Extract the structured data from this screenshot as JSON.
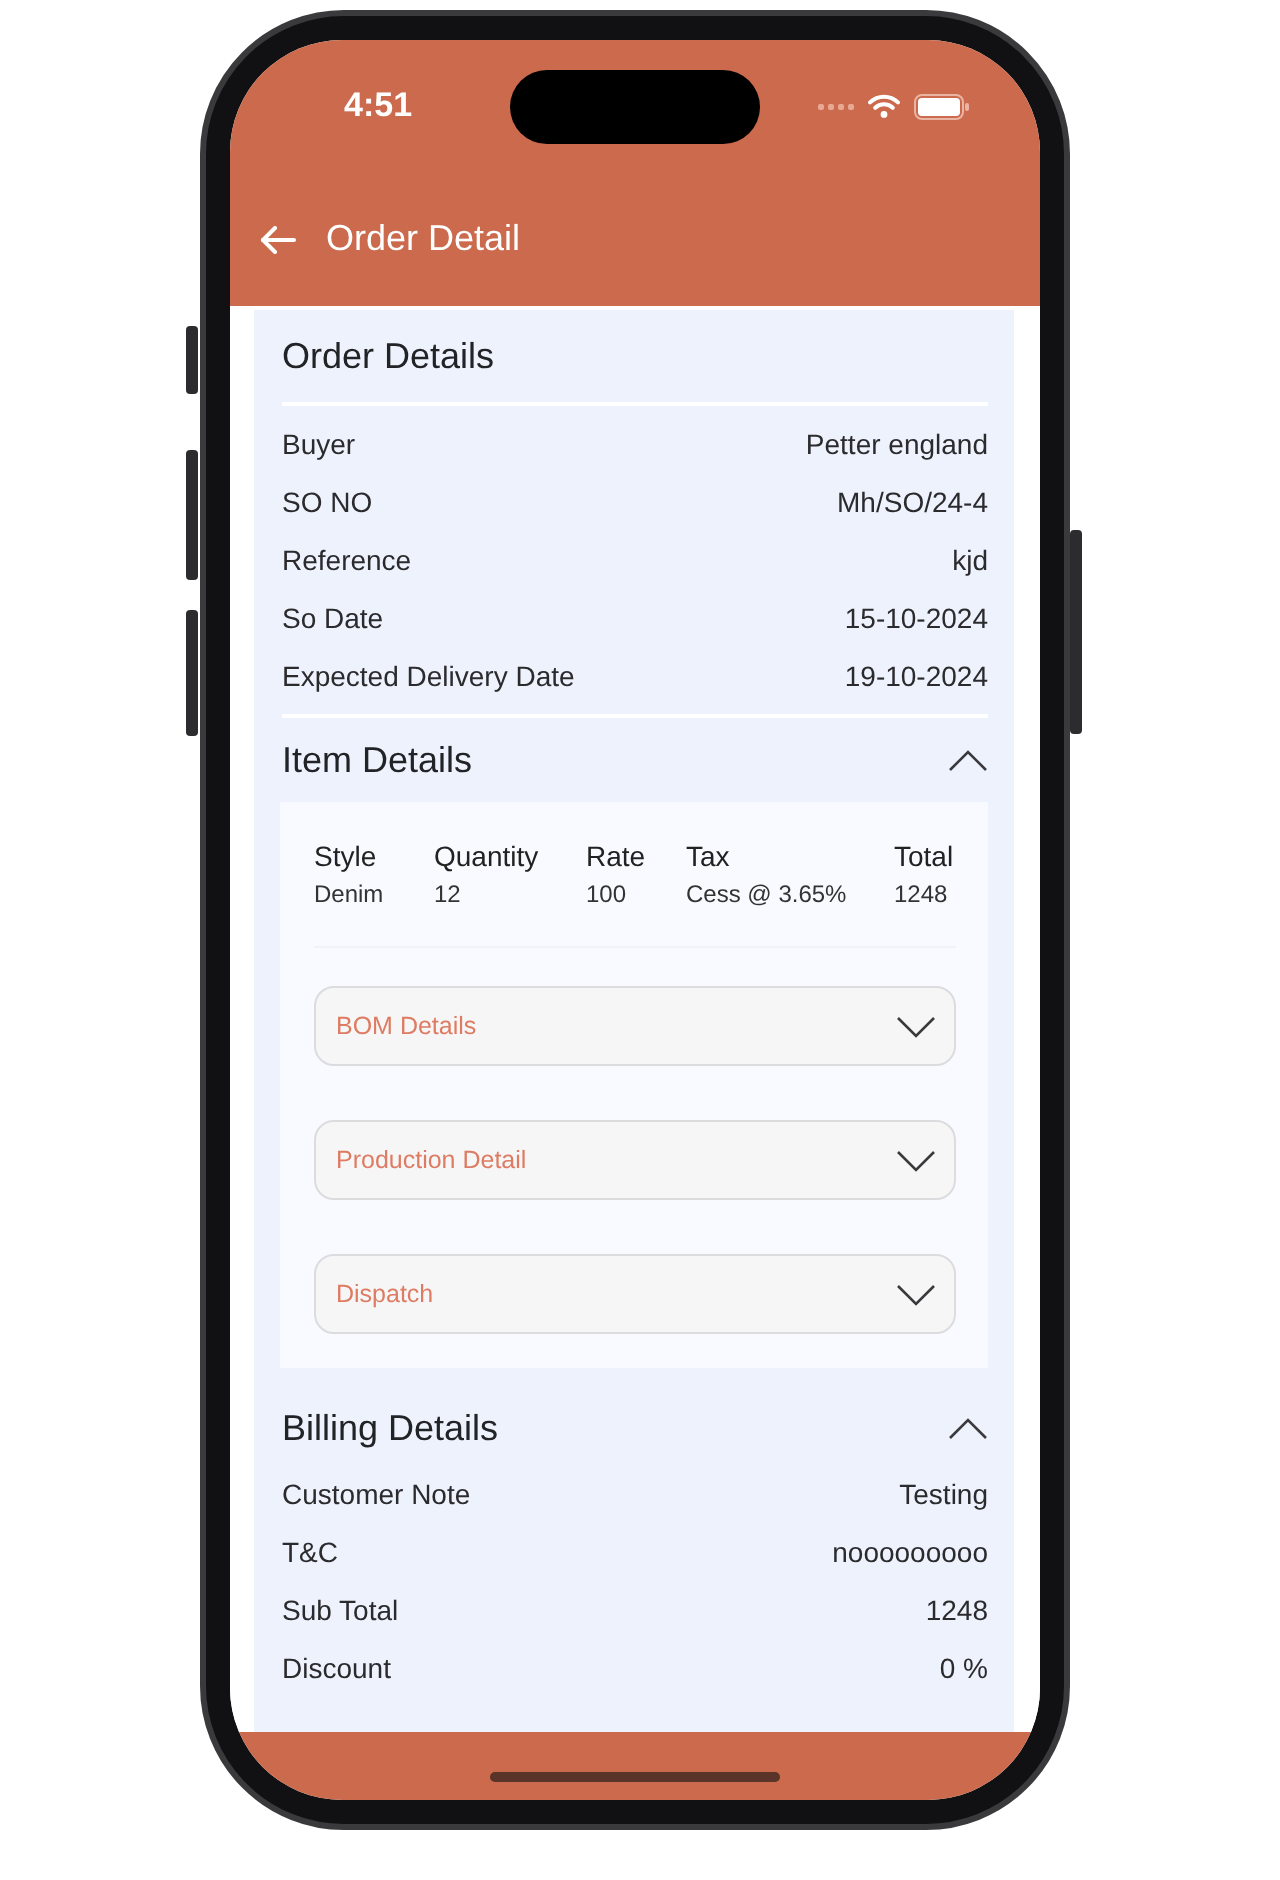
{
  "status_bar": {
    "time": "4:51"
  },
  "app_bar": {
    "title": "Order Detail"
  },
  "order_details": {
    "title": "Order Details",
    "rows": [
      {
        "label": "Buyer",
        "value": "Petter england"
      },
      {
        "label": "SO NO",
        "value": "Mh/SO/24-4"
      },
      {
        "label": "Reference",
        "value": "kjd"
      },
      {
        "label": "So Date",
        "value": "15-10-2024"
      },
      {
        "label": "Expected Delivery Date",
        "value": "19-10-2024"
      }
    ]
  },
  "item_details": {
    "title": "Item Details",
    "expanded": true,
    "table": {
      "columns": [
        "Style",
        "Quantity",
        "Rate",
        "Tax",
        "Total"
      ],
      "rows": [
        [
          "Denim",
          "12",
          "100",
          "Cess @ 3.65%",
          "1248"
        ]
      ]
    },
    "sections": [
      {
        "label": "BOM Details",
        "expanded": false
      },
      {
        "label": "Production Detail",
        "expanded": false
      },
      {
        "label": "Dispatch",
        "expanded": false
      }
    ]
  },
  "billing_details": {
    "title": "Billing Details",
    "expanded": true,
    "rows": [
      {
        "label": "Customer Note",
        "value": "Testing"
      },
      {
        "label": "T&C",
        "value": "nooooooooo"
      },
      {
        "label": "Sub Total",
        "value": "1248"
      },
      {
        "label": "Discount",
        "value": "0 %"
      }
    ]
  }
}
